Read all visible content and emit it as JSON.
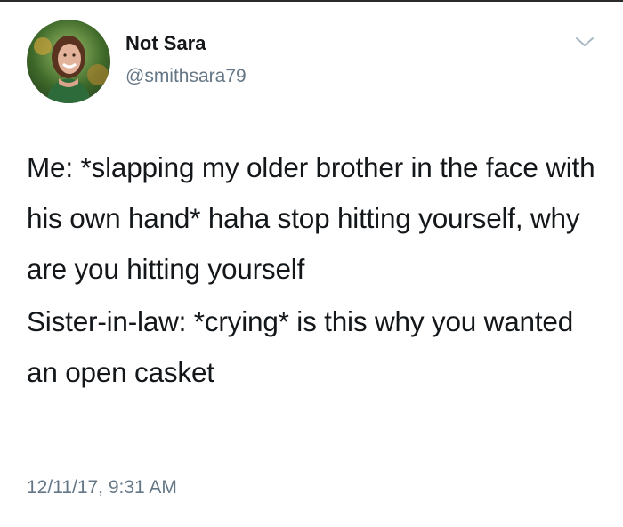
{
  "user": {
    "display_name": "Not Sara",
    "handle": "@smithsara79",
    "avatar_icon": "profile-photo"
  },
  "menu": {
    "icon": "chevron-down-icon"
  },
  "tweet": {
    "paragraphs": [
      "Me: *slapping my older brother in the face with his own hand* haha stop hitting yourself, why are you hitting yourself",
      "Sister-in-law: *crying* is this why you wanted an open casket"
    ],
    "timestamp": "12/11/17, 9:31 AM"
  },
  "colors": {
    "text": "#14171a",
    "secondary": "#657786",
    "background": "#ffffff"
  }
}
